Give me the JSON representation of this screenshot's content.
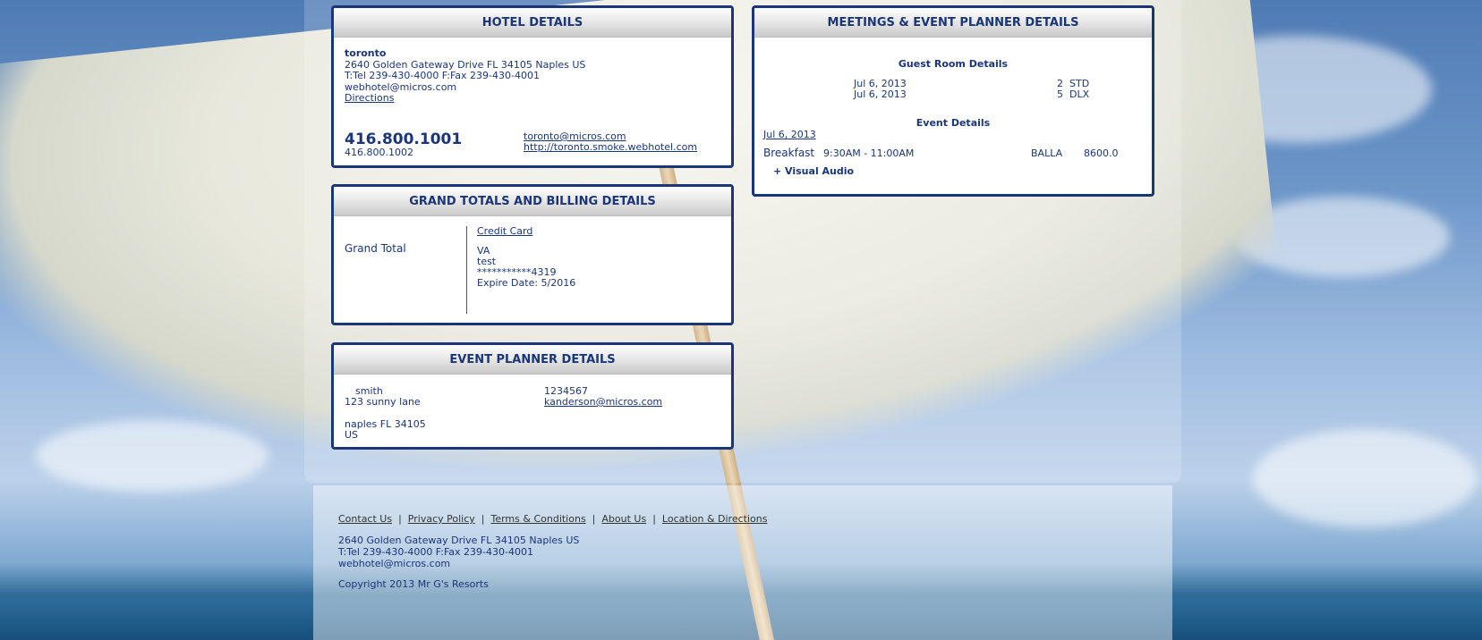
{
  "hotel": {
    "header": "HOTEL DETAILS",
    "name": "toronto",
    "address": "2640 Golden Gateway Drive FL 34105 Naples US",
    "tel_fax": "T:Tel 239-430-4000 F:Fax 239-430-4001",
    "email": "webhotel@micros.com",
    "directions": "Directions",
    "phone_primary": "416.800.1001",
    "phone_secondary": "416.800.1002",
    "contact_email": "toronto@micros.com",
    "website": "http://toronto.smoke.webhotel.com"
  },
  "meetings": {
    "header": "MEETINGS & EVENT PLANNER DETAILS",
    "guest_room_title": "Guest Room Details",
    "rooms": [
      {
        "date": "Jul 6, 2013",
        "qty": "2",
        "type": "STD"
      },
      {
        "date": "Jul 6, 2013",
        "qty": "5",
        "type": "DLX"
      }
    ],
    "event_title": "Event Details",
    "event_date": "Jul 6, 2013",
    "event": {
      "name": "Breakfast",
      "time": "9:30AM - 11:00AM",
      "room": "BALLA",
      "amount": "8600.0"
    },
    "addon": "+ Visual Audio"
  },
  "billing": {
    "header": "GRAND TOTALS AND BILLING DETAILS",
    "grand_total_label": "Grand Total",
    "payment_method": "Credit Card",
    "card_type": "VA",
    "card_name": "test",
    "card_number": "***********4319",
    "expire": "Expire Date: 5/2016"
  },
  "planner": {
    "header": "EVENT PLANNER DETAILS",
    "name": "smith",
    "street": "123 sunny lane",
    "city": "naples FL 34105",
    "country": "US",
    "phone": "1234567",
    "email": "kanderson@micros.com"
  },
  "footer": {
    "links": [
      "Contact Us",
      "Privacy Policy",
      "Terms & Conditions",
      "About Us",
      "Location & Directions"
    ],
    "address": "2640 Golden Gateway Drive FL 34105 Naples US",
    "tel_fax": "T:Tel 239-430-4000 F:Fax 239-430-4001",
    "email": "webhotel@micros.com",
    "copyright": "Copyright 2013  Mr G's Resorts"
  },
  "colors": {
    "text": "#1a3578",
    "border": "#1a3578"
  }
}
